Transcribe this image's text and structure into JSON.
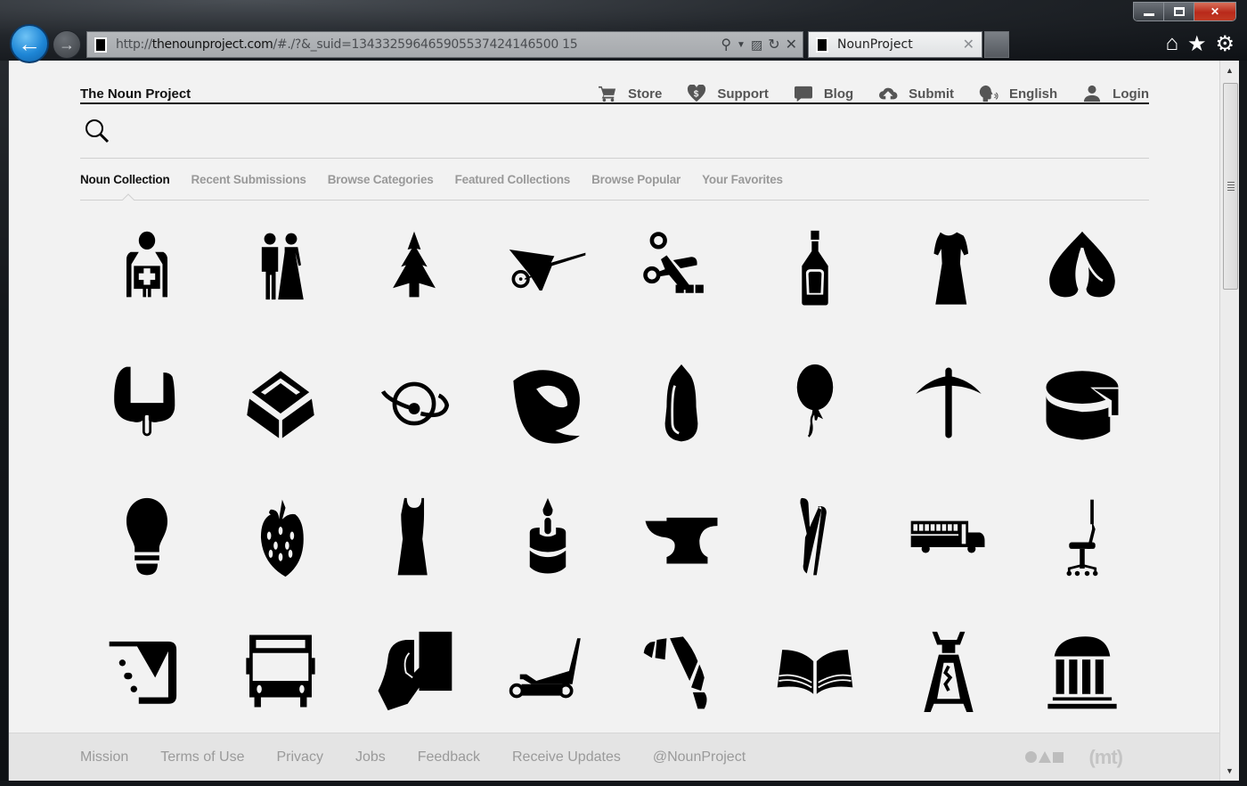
{
  "browser": {
    "url_prefix": "http://",
    "url_domain": "thenounproject.com",
    "url_suffix": "/#./?&_suid=134332596465905537424146500 15",
    "tab_title": "NounProject",
    "icons": [
      "back-arrow",
      "forward-arrow",
      "search",
      "dropdown",
      "compatibility-view",
      "refresh",
      "stop",
      "home",
      "favorites-star",
      "settings-gear"
    ]
  },
  "header": {
    "site_title": "The Noun Project",
    "nav": [
      {
        "label": "Store",
        "icon": "cart-icon"
      },
      {
        "label": "Support",
        "icon": "heart-dollar-icon"
      },
      {
        "label": "Blog",
        "icon": "speech-bubble-icon"
      },
      {
        "label": "Submit",
        "icon": "cloud-upload-icon"
      },
      {
        "label": "English",
        "icon": "speaking-head-icon"
      },
      {
        "label": "Login",
        "icon": "user-icon"
      }
    ]
  },
  "search": {
    "placeholder": "",
    "value": ""
  },
  "subnav": {
    "active_index": 0,
    "items": [
      "Noun Collection",
      "Recent Submissions",
      "Browse Categories",
      "Featured Collections",
      "Browse Popular",
      "Your Favorites"
    ]
  },
  "icon_grid": [
    [
      "medic-person",
      "bride-and-groom",
      "pine-tree",
      "wheelbarrow",
      "scissors-cutting",
      "liquor-bottle",
      "dress",
      "onion-dome"
    ],
    [
      "thyroid",
      "square-tile",
      "planet-orbit",
      "leaf-drop",
      "seed",
      "balloon",
      "pickaxe",
      "cheese-wheel"
    ],
    [
      "light-bulb",
      "strawberry",
      "tank-dress",
      "candle-cake",
      "anvil",
      "tongs",
      "school-bus",
      "office-chair"
    ],
    [
      "fast-mail",
      "bus-front",
      "hand-holding-card",
      "floor-jack",
      "croissant",
      "open-book",
      "corkscrew",
      "columned-building"
    ]
  ],
  "footer": {
    "links": [
      "Mission",
      "Terms of Use",
      "Privacy",
      "Jobs",
      "Feedback",
      "Receive Updates",
      "@NounProject"
    ],
    "logo_mt": "(mt)"
  }
}
